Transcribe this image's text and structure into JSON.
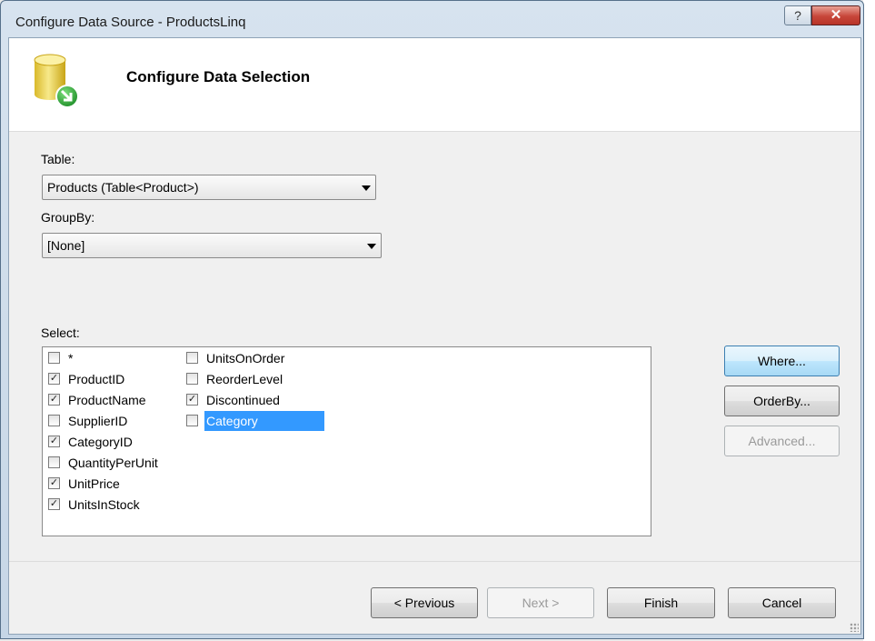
{
  "window": {
    "title": "Configure Data Source - ProductsLinq",
    "help_label": "?",
    "close_label": "✕"
  },
  "header": {
    "title": "Configure Data Selection",
    "icon": "database-icon"
  },
  "table": {
    "label": "Table:",
    "value": "Products (Table<Product>)"
  },
  "groupby": {
    "label": "GroupBy:",
    "value": "[None]"
  },
  "select": {
    "label": "Select:",
    "columns": [
      [
        {
          "label": "*",
          "checked": false
        },
        {
          "label": "ProductID",
          "checked": true
        },
        {
          "label": "ProductName",
          "checked": true
        },
        {
          "label": "SupplierID",
          "checked": false
        },
        {
          "label": "CategoryID",
          "checked": true
        },
        {
          "label": "QuantityPerUnit",
          "checked": false
        },
        {
          "label": "UnitPrice",
          "checked": true
        },
        {
          "label": "UnitsInStock",
          "checked": true
        }
      ],
      [
        {
          "label": "UnitsOnOrder",
          "checked": false
        },
        {
          "label": "ReorderLevel",
          "checked": false
        },
        {
          "label": "Discontinued",
          "checked": true
        },
        {
          "label": "Category",
          "checked": false,
          "selected": true
        }
      ]
    ]
  },
  "side_buttons": {
    "where": "Where...",
    "orderby": "OrderBy...",
    "advanced": "Advanced..."
  },
  "footer": {
    "previous": "< Previous",
    "next": "Next >",
    "finish": "Finish",
    "cancel": "Cancel"
  },
  "colors": {
    "selection": "#3399ff",
    "close_button": "#c7463a"
  }
}
